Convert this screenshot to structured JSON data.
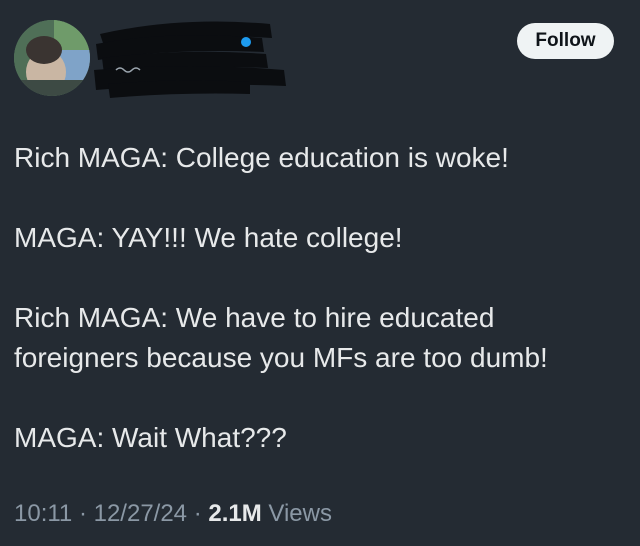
{
  "header": {
    "follow_label": "Follow"
  },
  "tweet": {
    "lines": [
      "Rich MAGA: College education is woke!",
      "MAGA: YAY!!! We hate college!",
      "Rich MAGA: We have to hire educated",
      "foreigners because you MFs are too dumb!",
      "MAGA: Wait What???"
    ]
  },
  "meta": {
    "time": "10:11",
    "separator": " · ",
    "date": "12/27/24",
    "views_count": "2.1M",
    "views_label": " Views"
  },
  "colors": {
    "background": "#242b33",
    "text": "#e7e9ea",
    "muted": "#8b98a5",
    "follow_bg": "#eff3f4",
    "verified": "#1d9bf0",
    "redaction": "#0b0d10"
  }
}
